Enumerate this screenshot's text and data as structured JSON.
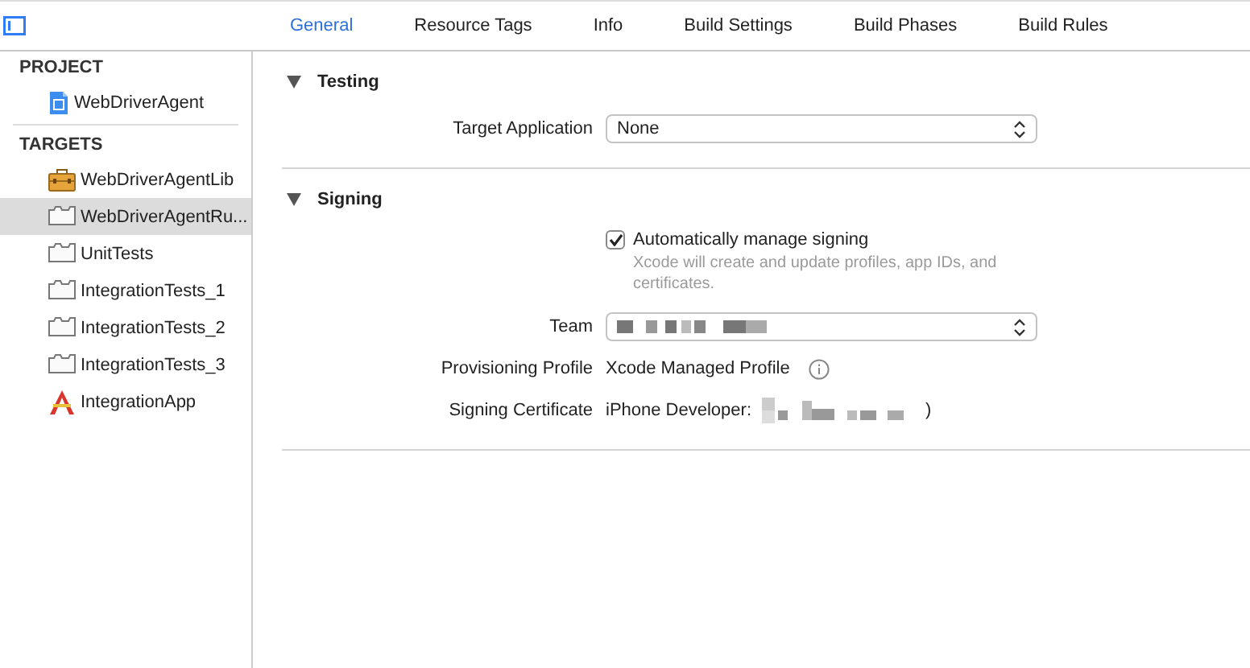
{
  "tabs": [
    {
      "label": "General",
      "selected": true
    },
    {
      "label": "Resource Tags",
      "selected": false
    },
    {
      "label": "Info",
      "selected": false
    },
    {
      "label": "Build Settings",
      "selected": false
    },
    {
      "label": "Build Phases",
      "selected": false
    },
    {
      "label": "Build Rules",
      "selected": false
    }
  ],
  "sidebar": {
    "sections": [
      {
        "title": "PROJECT",
        "items": [
          {
            "label": "WebDriverAgent",
            "kind": "project",
            "selected": false
          }
        ]
      },
      {
        "title": "TARGETS",
        "items": [
          {
            "label": "WebDriverAgentLib",
            "kind": "framework",
            "selected": false
          },
          {
            "label": "WebDriverAgentRu...",
            "kind": "bundle",
            "selected": true
          },
          {
            "label": "UnitTests",
            "kind": "bundle",
            "selected": false
          },
          {
            "label": "IntegrationTests_1",
            "kind": "bundle",
            "selected": false
          },
          {
            "label": "IntegrationTests_2",
            "kind": "bundle",
            "selected": false
          },
          {
            "label": "IntegrationTests_3",
            "kind": "bundle",
            "selected": false
          },
          {
            "label": "IntegrationApp",
            "kind": "app",
            "selected": false
          }
        ]
      }
    ]
  },
  "sections": [
    {
      "title": "Testing",
      "expanded": true,
      "rows": [
        {
          "kind": "popup",
          "label": "Target Application",
          "value": "None"
        }
      ]
    },
    {
      "title": "Signing",
      "expanded": true,
      "rows": [
        {
          "kind": "checkbox",
          "label": "Automatically manage signing",
          "checked": true,
          "hint": "Xcode will create and update profiles, app IDs, and certificates."
        },
        {
          "kind": "popup",
          "label": "Team",
          "redacted": true
        },
        {
          "kind": "info",
          "label": "Provisioning Profile",
          "value": "Xcode Managed Profile"
        },
        {
          "kind": "text",
          "label": "Signing Certificate",
          "value": "iPhone Developer:",
          "redacted": true,
          "suffix": ")"
        }
      ]
    }
  ]
}
